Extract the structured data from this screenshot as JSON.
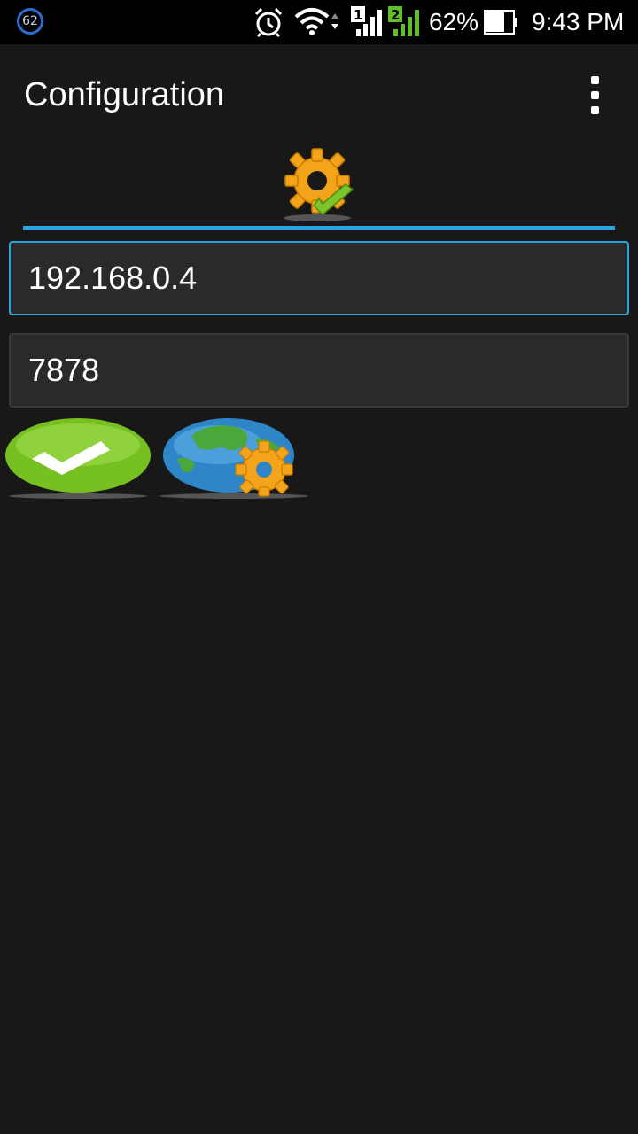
{
  "status_bar": {
    "notification_badge": "62",
    "sim1_label": "1",
    "sim2_label": "2",
    "battery_percent": "62%",
    "time": "9:43 PM",
    "icons": [
      "alarm-icon",
      "wifi-icon",
      "signal-sim1-icon",
      "signal-sim2-icon",
      "battery-icon"
    ]
  },
  "app_bar": {
    "title": "Configuration",
    "menu_icon": "overflow-menu-icon"
  },
  "tabs": [
    {
      "icon": "gear-check-icon",
      "selected": true
    }
  ],
  "form": {
    "host_value": "192.168.0.4",
    "port_value": "7878"
  },
  "actions": [
    {
      "icon": "green-check-button-icon"
    },
    {
      "icon": "globe-gear-button-icon"
    }
  ],
  "colors": {
    "background": "#181818",
    "accent": "#27a5e3",
    "field_bg": "#2a2a2a"
  }
}
